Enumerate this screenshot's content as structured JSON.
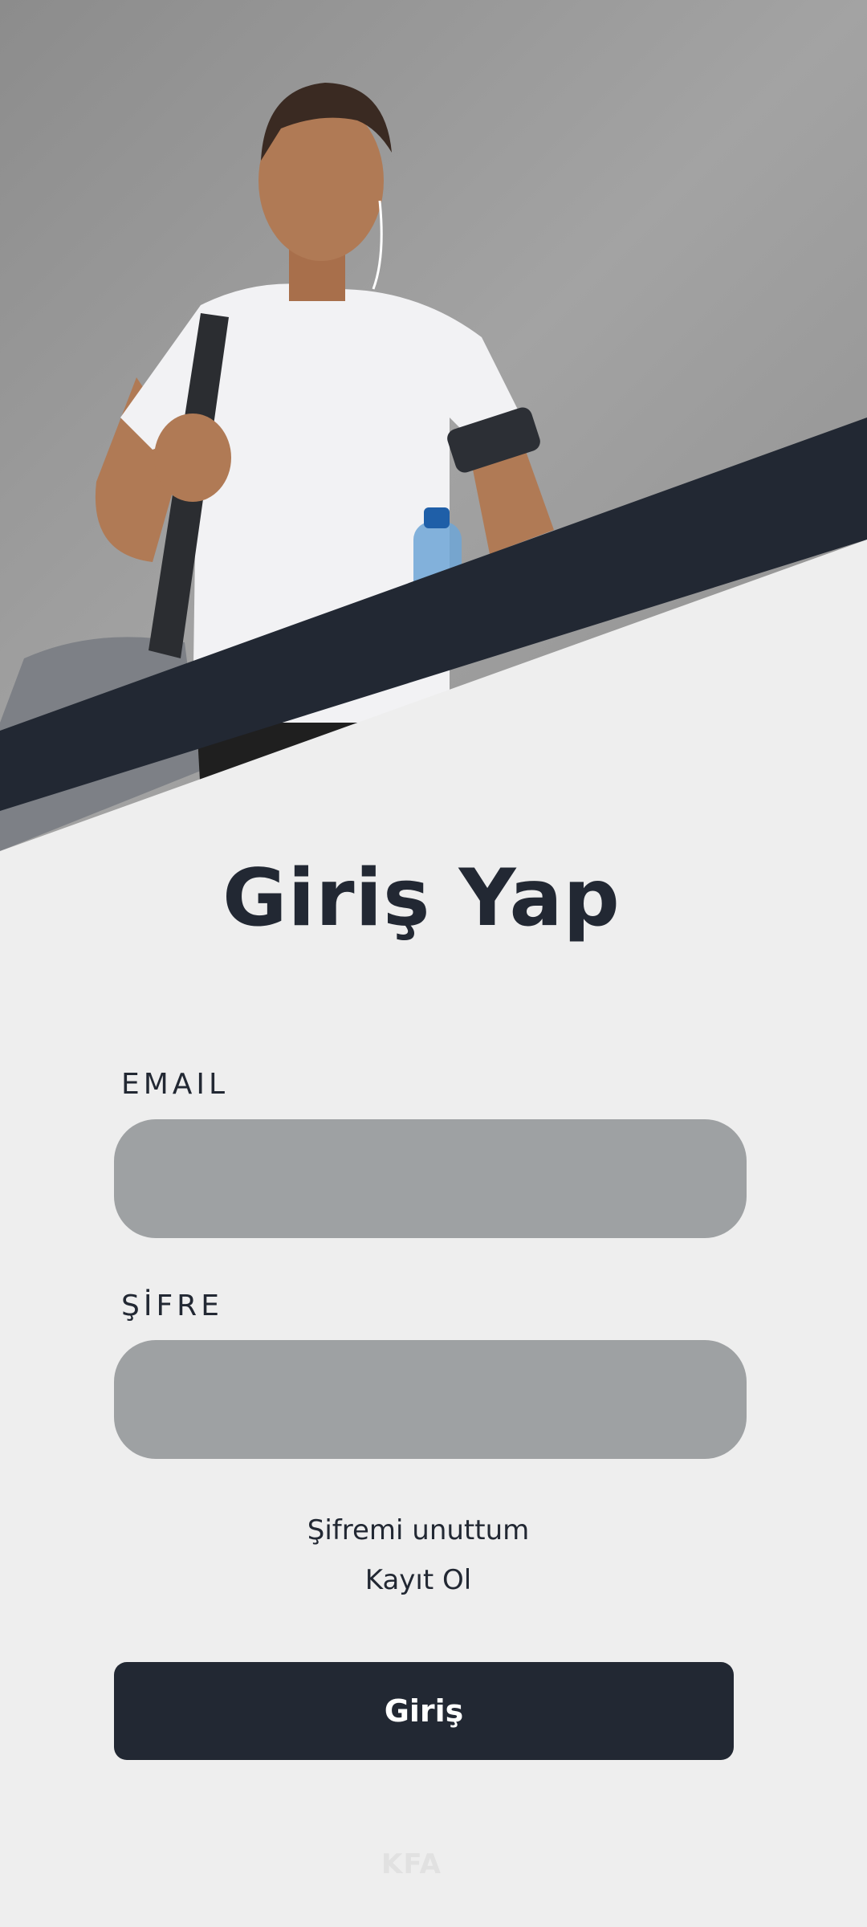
{
  "login": {
    "title": "Giriş Yap",
    "email_label": "EMAIL",
    "email_value": "",
    "password_label": "ŞİFRE",
    "password_value": "",
    "forgot_link": "Şifremi unuttum",
    "register_link": "Kayıt Ol",
    "submit_label": "Giriş"
  },
  "footer": {
    "brand": "KFA"
  },
  "colors": {
    "background": "#eeeeee",
    "primary_dark": "#222833",
    "input_fill": "#9ea1a3",
    "button_text": "#ffffff",
    "footer_text": "#e1e1e1"
  }
}
